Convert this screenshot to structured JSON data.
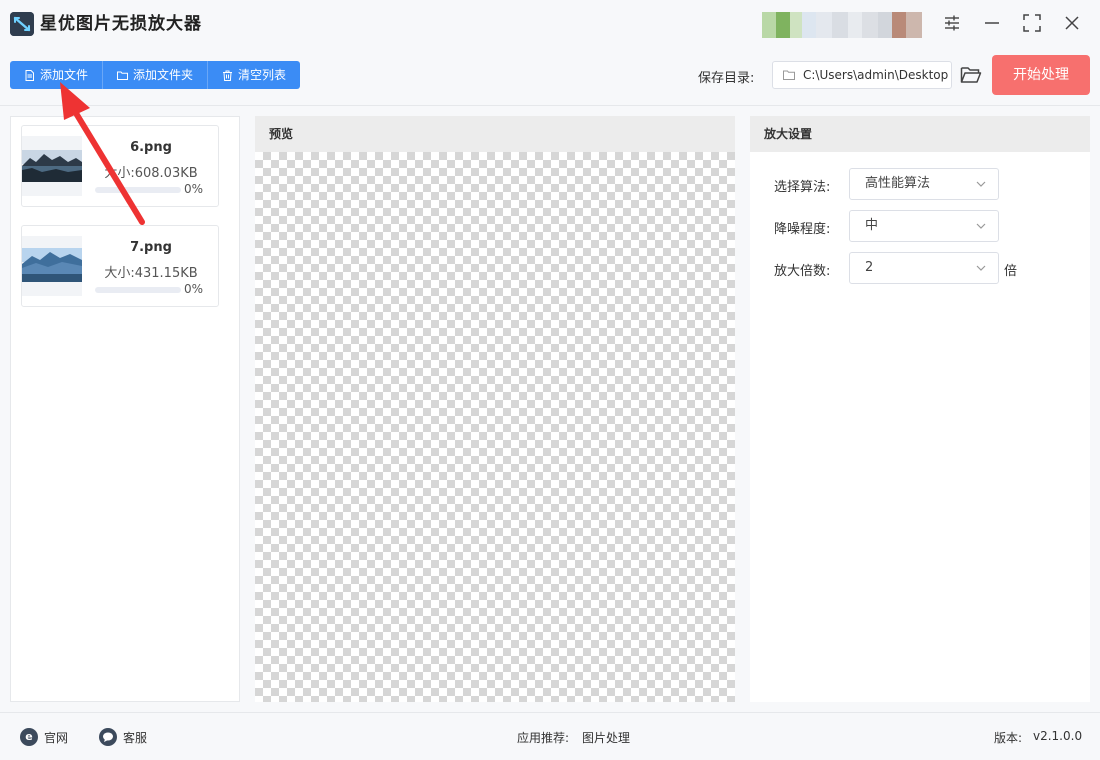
{
  "app": {
    "title": "星优图片无损放大器"
  },
  "window_controls": {
    "settings_icon": "sliders-icon",
    "minimize_icon": "minimize-icon",
    "maximize_icon": "maximize-icon",
    "close_icon": "close-icon"
  },
  "toolbar": {
    "add_file_label": "添加文件",
    "add_folder_label": "添加文件夹",
    "clear_list_label": "清空列表",
    "save_dir_label": "保存目录:",
    "save_dir_value": "C:\\Users\\admin\\Desktop",
    "start_label": "开始处理"
  },
  "files": [
    {
      "name": "6.png",
      "size": "大小:608.03KB",
      "progress_text": "0%",
      "progress": 0
    },
    {
      "name": "7.png",
      "size": "大小:431.15KB",
      "progress_text": "0%",
      "progress": 0
    }
  ],
  "preview": {
    "header": "预览"
  },
  "settings": {
    "header": "放大设置",
    "algorithm": {
      "label": "选择算法:",
      "value": "高性能算法"
    },
    "denoise": {
      "label": "降噪程度:",
      "value": "中"
    },
    "scale": {
      "label": "放大倍数:",
      "value": "2",
      "unit": "倍"
    }
  },
  "statusbar": {
    "website_label": "官网",
    "support_label": "客服",
    "recommend_label": "应用推荐:",
    "recommend_value": "图片处理",
    "version_label": "版本:",
    "version_value": "v2.1.0.0"
  },
  "colors": {
    "accent": "#3b8cf5",
    "start_button": "#f7706e",
    "annotation_arrow": "#ee3333"
  }
}
